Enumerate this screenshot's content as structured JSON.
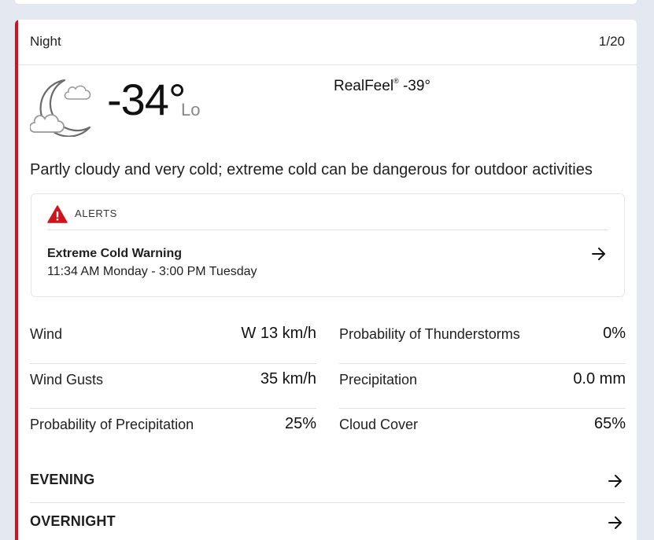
{
  "period": {
    "title": "Night",
    "date": "1/20"
  },
  "current": {
    "temperature": "-34°",
    "temp_qualifier": "Lo",
    "realfeel_label": "RealFeel",
    "realfeel_mark": "®",
    "realfeel_value": "-39°",
    "icon": "partly-cloudy-moon-icon",
    "phrase": "Partly cloudy and very cold; extreme cold can be dangerous for outdoor activities"
  },
  "alert": {
    "header": "ALERTS",
    "name": "Extreme Cold Warning",
    "time": "11:34 AM Monday - 3:00 PM Tuesday",
    "color": "#d0131c"
  },
  "details": {
    "left": [
      {
        "label": "Wind",
        "value": "W 13 km/h"
      },
      {
        "label": "Wind Gusts",
        "value": "35 km/h"
      },
      {
        "label": "Probability of Precipitation",
        "value": "25%"
      }
    ],
    "right": [
      {
        "label": "Probability of Thunderstorms",
        "value": "0%"
      },
      {
        "label": "Precipitation",
        "value": "0.0 mm"
      },
      {
        "label": "Cloud Cover",
        "value": "65%"
      }
    ]
  },
  "sections": {
    "evening": "EVENING",
    "overnight": "OVERNIGHT"
  },
  "colors": {
    "accent": "#d0131c",
    "background": "#e4e9f1"
  }
}
